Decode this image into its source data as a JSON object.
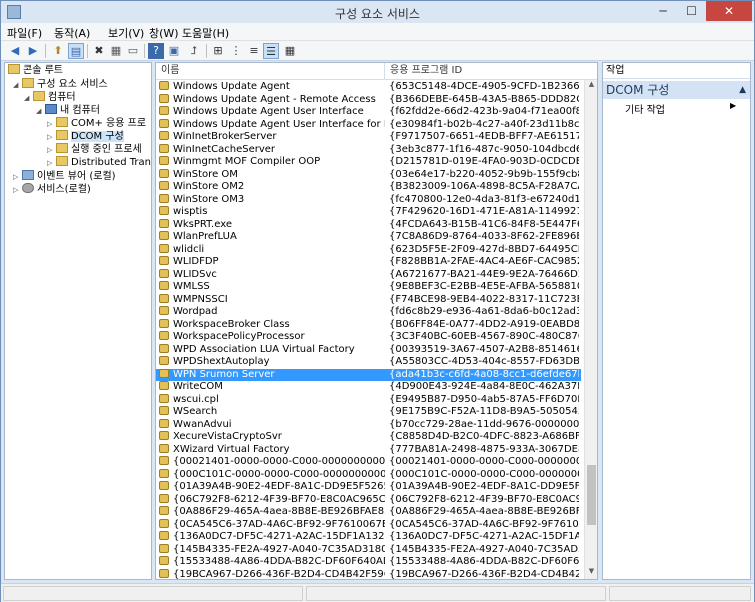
{
  "window": {
    "title": "구성 요소 서비스",
    "min_label": "─",
    "max_label": "☐",
    "close_label": "✕"
  },
  "menu": [
    "파일(F)",
    "동작(A)",
    "보기(V)",
    "창(W)",
    "도움말(H)"
  ],
  "toolbar": {
    "back_icon": "◀",
    "forward_icon": "▶",
    "up_icon": "⬆",
    "show_tree_icon": "▤",
    "delete_icon": "✖",
    "properties_icon": "▦",
    "export_icon": "▭",
    "help_icon": "?",
    "view_icon": "▣",
    "nav_icon": "⮥",
    "large_icons_icon": "⊞",
    "small_icons_icon": "⋮",
    "list_icon": "≡",
    "detail_icon": "☰",
    "status_icon": "▦"
  },
  "tree": [
    {
      "label": "콘솔 루트",
      "icon": "folder-icon"
    },
    {
      "label": "구성 요소 서비스",
      "icon": "folder-icon"
    },
    {
      "label": "컴퓨터",
      "icon": "folder-icon"
    },
    {
      "label": "내 컴퓨터",
      "icon": "computer-icon"
    },
    {
      "label": "COM+ 응용 프로",
      "icon": "folder-icon"
    },
    {
      "label": "DCOM 구성",
      "icon": "folder-icon"
    },
    {
      "label": "실행 중인 프로세",
      "icon": "folder-icon"
    },
    {
      "label": "Distributed Trans",
      "icon": "folder-icon"
    },
    {
      "label": "이벤트 뷰어 (로컬)",
      "icon": "event-viewer-icon"
    },
    {
      "label": "서비스(로컬)",
      "icon": "services-icon"
    }
  ],
  "list": {
    "columns": [
      "이름",
      "응용 프로그램 ID"
    ],
    "selected_index": 24,
    "rows": [
      [
        "Windows Update Agent",
        "{653C5148-4DCE-4905-9CFD-1B23662D3..."
      ],
      [
        "Windows Update Agent - Remote Access",
        "{B366DEBE-645B-43A5-B865-DDD82C345..."
      ],
      [
        "Windows Update Agent User Interface",
        "{f62fdd2e-66d2-423b-9a04-f71ea00f892a}"
      ],
      [
        "Windows Update Agent User Interface for Publishe...",
        "{e30984f1-b02b-4c27-a40f-23d11b8c1212}"
      ],
      [
        "WinInetBrokerServer",
        "{F9717507-6651-4EDB-BFF7-AE615179BC..."
      ],
      [
        "WinInetCacheServer",
        "{3eb3c877-1f16-487c-9050-104dbcd66683}"
      ],
      [
        "Winmgmt MOF Compiler OOP",
        "{D215781D-019E-4FA0-903D-0CDCDE13A..."
      ],
      [
        "WinStore OM",
        "{03e64e17-b220-4052-9b9b-155f9cb8e016}"
      ],
      [
        "WinStore OM2",
        "{B3823009-106A-4898-8C5A-F28A7CA83E..."
      ],
      [
        "WinStore OM3",
        "{fc470800-12e0-4da3-81f3-e67240d19093}"
      ],
      [
        "wisptis",
        "{7F429620-16D1-471E-A81A-1149921480..."
      ],
      [
        "WksPRT.exe",
        "{4FCDA643-B15B-41C6-84F8-5E447F6F6D..."
      ],
      [
        "WlanPrefLUA",
        "{7C8A86D9-8764-4033-8F62-2FE896E548..."
      ],
      [
        "wlidcli",
        "{623D5F5E-2F09-427d-8BD7-64495CD983..."
      ],
      [
        "WLIDFDP",
        "{F828BB1A-2FAE-4AC4-AE6F-CAC98529F9..."
      ],
      [
        "WLIDSvc",
        "{A6721677-BA21-44E9-9E2A-76466D24D1..."
      ],
      [
        "WMLSS",
        "{9E8BEF3C-E2BB-4E5E-AFBA-565881069D7..."
      ],
      [
        "WMPNSSCI",
        "{F74BCE98-9EB4-4022-8317-11C723E5CC..."
      ],
      [
        "Wordpad",
        "{fd6c8b29-e936-4a61-8da6-b0c12ad3ba00}"
      ],
      [
        "WorkspaceBroker Class",
        "{B06FF84E-0A77-4DD2-A919-0EABD8979..."
      ],
      [
        "WorkspacePolicyProcessor",
        "{3C3F40BC-60EB-4567-890C-480C87C21A..."
      ],
      [
        "WPD Association LUA Virtual Factory",
        "{00393519-3A67-4507-A2B8-85146167AC..."
      ],
      [
        "WPDShextAutoplay",
        "{A55803CC-4D53-404c-8557-FD63DBA95..."
      ],
      [
        "WPN Srumon Server",
        "{ada41b3c-c6fd-4a08-8cc1-d6efde67be7d}"
      ],
      [
        "WPN Srumon Server",
        "{ada41b3c-c6fd-4a08-8cc1-d6efde67be7d}"
      ],
      [
        "WriteCOM",
        "{4D900E43-924E-4a84-8E0C-462A37DF23..."
      ],
      [
        "wscui.cpl",
        "{E9495B87-D950-4ab5-87A5-FF6D70BF3E..."
      ],
      [
        "WSearch",
        "{9E175B9C-F52A-11D8-B9A5-5050545030..."
      ],
      [
        "WwanAdvui",
        "{b70cc729-28ae-11dd-9676-00000000000}"
      ],
      [
        "XecureVistaCryptoSvr",
        "{C8858D4D-B2C0-4DFC-8823-A686BFF0E..."
      ],
      [
        "XWizard Virtual Factory",
        "{777BA81A-2498-4875-933A-3067DE8830..."
      ],
      [
        "{00021401-0000-0000-C000-000000000046}",
        "{00021401-0000-0000-C000-000000000..."
      ],
      [
        "{000C101C-0000-0000-C000-000000000046}",
        "{000C101C-0000-0000-C000-000000000..."
      ],
      [
        "{01A39A4B-90E2-4EDF-8A1C-DD9E5F526568}",
        "{01A39A4B-90E2-4EDF-8A1C-DD9E5F5265..."
      ],
      [
        "{06C792F8-6212-4F39-BF70-E8C0AC965C23}",
        "{06C792F8-6212-4F39-BF70-E8C0AC965C..."
      ],
      [
        "{0A886F29-465A-4aea-8B8E-BE926BFAE83E}",
        "{0A886F29-465A-4aea-8B8E-BE926BFAE83E}"
      ],
      [
        "{0CA545C6-37AD-4A6C-BF92-9F7610067EF5}",
        "{0CA545C6-37AD-4A6C-BF92-9F7610067E..."
      ],
      [
        "{136A0DC7-DF5C-4271-A2AC-15DF1A1323F2}",
        "{136A0DC7-DF5C-4271-A2AC-15DF1A132..."
      ],
      [
        "{145B4335-FE2A-4927-A040-7C35AD3180EF}",
        "{145B4335-FE2A-4927-A040-7C35AD3180..."
      ],
      [
        "{15533488-4A86-4DDA-B82C-DF60F640ADF4}",
        "{15533488-4A86-4DDA-B82C-DF60F640A..."
      ],
      [
        "{19BCA967-D266-436F-B2D4-CD4B42F596}",
        "{19BCA967-D266-436F-B2D4-CD4B42F..."
      ]
    ]
  },
  "actions": {
    "header": "작업",
    "section_title": "DCOM 구성",
    "section_arrow": "▲",
    "item": "기타 작업",
    "item_arrow": "▶"
  }
}
